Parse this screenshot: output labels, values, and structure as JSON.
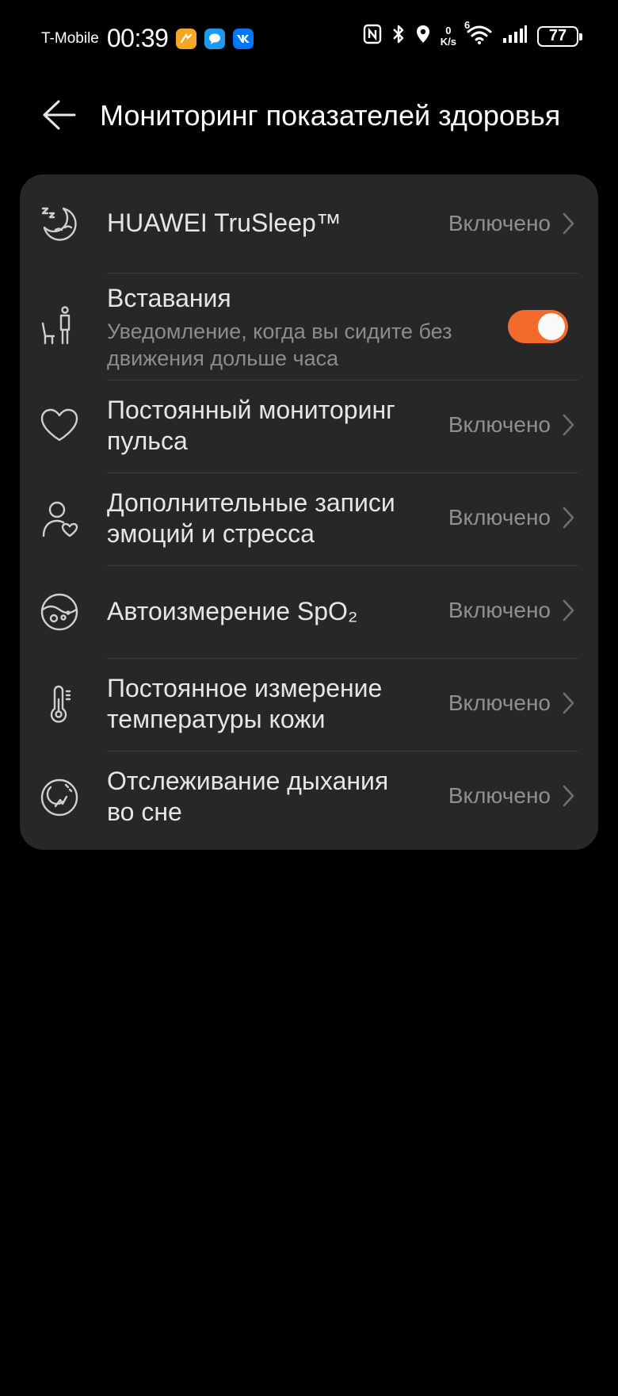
{
  "status_bar": {
    "carrier": "T-Mobile",
    "time": "00:39",
    "net_speed_value": "0",
    "net_speed_unit": "K/s",
    "wifi_label": "6",
    "battery": "77",
    "app_icons": [
      "orange-app-icon",
      "messages-icon",
      "vk-icon"
    ],
    "system_icons": [
      "nfc-icon",
      "bluetooth-icon",
      "location-icon",
      "wifi-icon",
      "signal-icon",
      "battery-icon"
    ]
  },
  "header": {
    "back_icon": "arrow-left-icon",
    "title": "Мониторинг показателей здоровья"
  },
  "settings": {
    "trusleep": {
      "title": "HUAWEI TruSleep™",
      "value": "Включено",
      "icon": "sleep-moon-icon"
    },
    "standing": {
      "title": "Вставания",
      "subtitle_1": "Уведомление, когда вы сидите без",
      "subtitle_2": "движения дольше часа",
      "enabled": true,
      "icon": "standing-person-icon"
    },
    "heart_rate": {
      "title_1": "Постоянный мониторинг",
      "title_2": "пульса",
      "value": "Включено",
      "icon": "heart-icon"
    },
    "stress": {
      "title_1": "Дополнительные записи",
      "title_2": "эмоций и стресса",
      "value": "Включено",
      "icon": "person-heart-icon"
    },
    "spo2": {
      "title": "Автоизмерение SpO₂",
      "value": "Включено",
      "icon": "blood-oxygen-icon"
    },
    "skin_temp": {
      "title_1": "Постоянное измерение",
      "title_2": "температуры кожи",
      "value": "Включено",
      "icon": "thermometer-icon"
    },
    "breathing": {
      "title_1": "Отслеживание дыхания",
      "title_2": "во сне",
      "value": "Включено",
      "icon": "sleep-breathing-icon"
    }
  },
  "colors": {
    "accent": "#f36a2d",
    "card_background": "#272727",
    "page_background": "#000000"
  }
}
